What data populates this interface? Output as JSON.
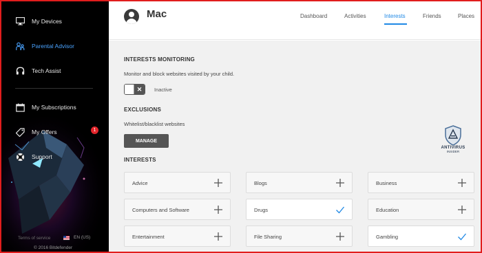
{
  "sidebar": {
    "items": [
      {
        "label": "My Devices",
        "icon": "monitor-icon",
        "active": false
      },
      {
        "label": "Parental Advisor",
        "icon": "family-icon",
        "active": true
      },
      {
        "label": "Tech Assist",
        "icon": "headset-icon",
        "active": false
      },
      {
        "label": "My Subscriptions",
        "icon": "calendar-icon",
        "active": false
      },
      {
        "label": "My Offers",
        "icon": "tag-icon",
        "active": false,
        "badge": "1"
      },
      {
        "label": "Support",
        "icon": "lifebuoy-icon",
        "active": false
      }
    ],
    "footer": {
      "terms": "Terms of service",
      "language": "EN (US)",
      "copyright": "© 2016 Bitdefender"
    }
  },
  "header": {
    "device_name": "Mac",
    "tabs": [
      {
        "label": "Dashboard",
        "active": false
      },
      {
        "label": "Activities",
        "active": false
      },
      {
        "label": "Interests",
        "active": true
      },
      {
        "label": "Friends",
        "active": false
      },
      {
        "label": "Places",
        "active": false
      }
    ]
  },
  "main": {
    "monitoring": {
      "title": "INTERESTS MONITORING",
      "description": "Monitor and block websites visited by your child.",
      "toggle_on": false,
      "status": "Inactive"
    },
    "exclusions": {
      "title": "EXCLUSIONS",
      "description": "Whitelist/blacklist websites",
      "button": "MANAGE"
    },
    "interests": {
      "title": "INTERESTS",
      "items": [
        {
          "label": "Advice",
          "checked": false
        },
        {
          "label": "Blogs",
          "checked": false
        },
        {
          "label": "Business",
          "checked": false
        },
        {
          "label": "Computers and Software",
          "checked": false
        },
        {
          "label": "Drugs",
          "checked": true
        },
        {
          "label": "Education",
          "checked": false
        },
        {
          "label": "Entertainment",
          "checked": false
        },
        {
          "label": "File Sharing",
          "checked": false
        },
        {
          "label": "Gambling",
          "checked": true
        }
      ]
    },
    "watermark": {
      "text": "ANTIVIRUS",
      "sub": "INSIDER"
    }
  },
  "colors": {
    "accent": "#1e88e5",
    "sidebar_bg": "#000000",
    "badge": "#e3252b",
    "button": "#555555",
    "frame": "#e11d1d"
  }
}
